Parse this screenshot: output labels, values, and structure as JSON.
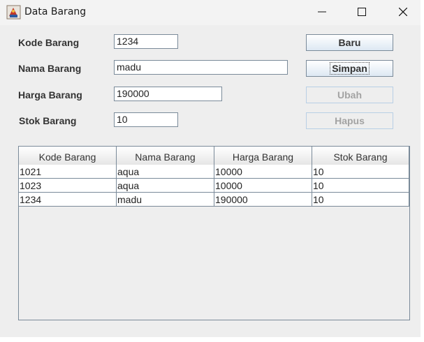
{
  "window": {
    "title": "Data Barang",
    "controls": [
      "minimize-icon",
      "maximize-icon",
      "close-icon"
    ]
  },
  "form": {
    "kode": {
      "label": "Kode Barang",
      "value": "1234"
    },
    "nama": {
      "label": "Nama Barang",
      "value": "madu"
    },
    "harga": {
      "label": "Harga Barang",
      "value": "190000"
    },
    "stok": {
      "label": "Stok Barang",
      "value": "10"
    }
  },
  "buttons": {
    "baru": {
      "label": "Baru",
      "enabled": true
    },
    "simpan": {
      "label": "Simpan",
      "enabled": true
    },
    "ubah": {
      "label": "Ubah",
      "enabled": false
    },
    "hapus": {
      "label": "Hapus",
      "enabled": false
    }
  },
  "table": {
    "columns": [
      "Kode Barang",
      "Nama Barang",
      "Harga Barang",
      "Stok Barang"
    ],
    "rows": [
      [
        "1021",
        "aqua",
        "10000",
        "10"
      ],
      [
        "1023",
        "aqua",
        "10000",
        "10"
      ],
      [
        "1234",
        "madu",
        "190000",
        "10"
      ]
    ]
  }
}
